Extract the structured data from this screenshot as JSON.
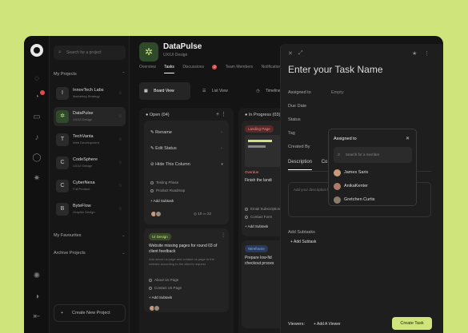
{
  "sidebar": {
    "search_placeholder": "Search for a project",
    "my_projects_label": "My Projects",
    "projects": [
      {
        "name": "InnovTech Labs",
        "sub": "Marketing Strategy",
        "active": false,
        "initial": "I"
      },
      {
        "name": "DataPulse",
        "sub": "UX/UI Design",
        "active": true,
        "initial": "✲"
      },
      {
        "name": "TechVanta",
        "sub": "Web Development",
        "active": false,
        "initial": "T"
      },
      {
        "name": "CodeSphere",
        "sub": "UX/UI Design",
        "active": false,
        "initial": "C"
      },
      {
        "name": "CyberNexa",
        "sub": "Full Product",
        "active": false,
        "initial": "C"
      },
      {
        "name": "ByteFlow",
        "sub": "Graphic Design",
        "active": false,
        "initial": "B"
      }
    ],
    "my_favourites_label": "My Favourites",
    "archive_label": "Archive Projects",
    "new_project_label": "Create New Project"
  },
  "header": {
    "title": "DataPulse",
    "subtitle": "UX/UI Design",
    "tabs": [
      {
        "label": "Overview"
      },
      {
        "label": "Tasks",
        "active": true
      },
      {
        "label": "Discussions",
        "badge": "2"
      },
      {
        "label": "Team Members"
      },
      {
        "label": "Notifications"
      }
    ],
    "views": [
      {
        "label": "Board View",
        "active": true
      },
      {
        "label": "List View"
      },
      {
        "label": "Timeline View"
      }
    ]
  },
  "columns": [
    {
      "title": "Open (04)",
      "menu": [
        "Rename",
        "Edit Status",
        "Hide This Column"
      ],
      "card1": {
        "checks": [
          "Testing Phase",
          "Product Roadmap"
        ],
        "add_subtask": "Add Subtask",
        "comments": "10",
        "attachments": "22"
      },
      "card2": {
        "tag": "UI Design",
        "title": "Website missing pages for round 03 of client feedback",
        "desc": "Add about us page and contact us page to the website according to the client's request",
        "checks": [
          "About Us Page",
          "Contact Us Page"
        ],
        "add_subtask": "Add Subtask",
        "comments": "10",
        "attachments": "22"
      }
    },
    {
      "title": "In Progress (03)",
      "card1": {
        "tag": "Landing Page",
        "title": "Finish the landi",
        "status": "Overdue",
        "checks": [
          "Email Subscription",
          "Contact Form"
        ],
        "add_subtask": "Add Subtask"
      },
      "card2": {
        "tag": "Wireframe",
        "title": "Prepare low-fid checkout proces"
      }
    }
  ],
  "panel": {
    "task_name_placeholder": "Enter your Task Name",
    "fields": [
      {
        "label": "Assigned to",
        "value": "Empty"
      },
      {
        "label": "Due Date",
        "value": ""
      },
      {
        "label": "Status",
        "value": ""
      },
      {
        "label": "Tag",
        "value": ""
      },
      {
        "label": "Created By",
        "value": ""
      }
    ],
    "tabs": [
      "Description",
      "Co"
    ],
    "desc_placeholder": "Add your description here...",
    "subtasks_label": "Add Subtasks",
    "add_subtask": "Add Subtask",
    "viewers_label": "Viewers:",
    "add_viewer": "Add A Viewer",
    "create_button": "Create Task"
  },
  "assign_dropdown": {
    "title": "Assigned to",
    "search_placeholder": "Search for a member",
    "members": [
      "James Saris",
      "AnikaKenter",
      "Gretchen Curtis"
    ]
  },
  "colors": {
    "accent": "#cfe47a",
    "background": "#141414",
    "badge": "#e04a4a"
  }
}
